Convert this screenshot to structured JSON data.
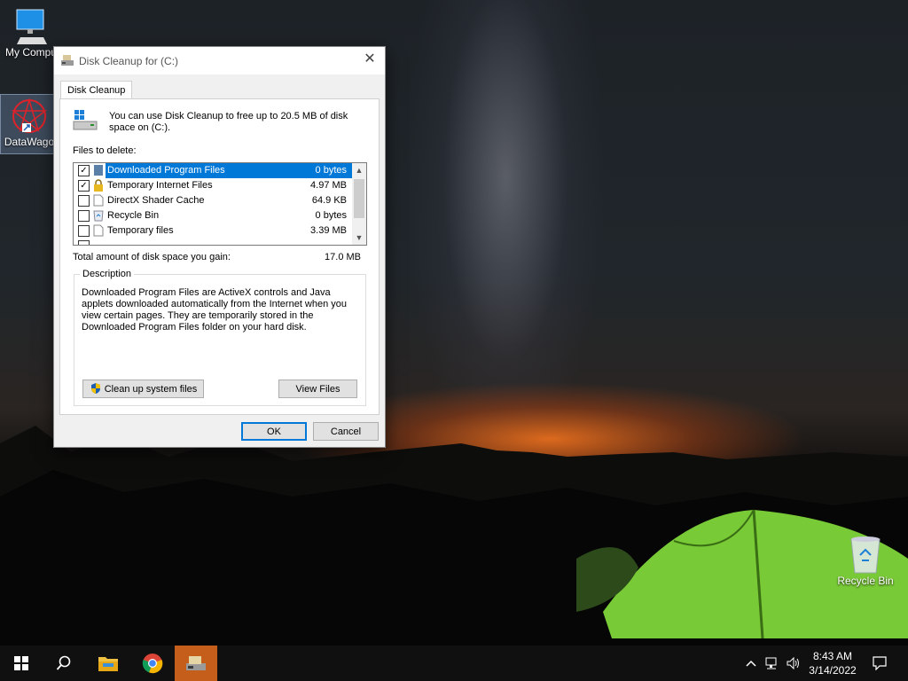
{
  "desktop": {
    "icons": [
      {
        "label": "My Compu"
      },
      {
        "label": "DataWago"
      },
      {
        "label": "Recycle Bin"
      }
    ]
  },
  "window": {
    "title": "Disk Cleanup for  (C:)",
    "tab": "Disk Cleanup",
    "intro": "You can use Disk Cleanup to free up to 20.5 MB of disk space on  (C:).",
    "files_label": "Files to delete:",
    "files": [
      {
        "name": "Downloaded Program Files",
        "size": "0 bytes",
        "checked": true,
        "selected": true,
        "icon": "folder-icon"
      },
      {
        "name": "Temporary Internet Files",
        "size": "4.97 MB",
        "checked": true,
        "selected": false,
        "icon": "lock-icon"
      },
      {
        "name": "DirectX Shader Cache",
        "size": "64.9 KB",
        "checked": false,
        "selected": false,
        "icon": "file-icon"
      },
      {
        "name": "Recycle Bin",
        "size": "0 bytes",
        "checked": false,
        "selected": false,
        "icon": "recycle-bin-icon"
      },
      {
        "name": "Temporary files",
        "size": "3.39 MB",
        "checked": false,
        "selected": false,
        "icon": "file-icon"
      }
    ],
    "total_label": "Total amount of disk space you gain:",
    "total_value": "17.0 MB",
    "description_title": "Description",
    "description": "Downloaded Program Files are ActiveX controls and Java applets downloaded automatically from the Internet when you view certain pages. They are temporarily stored in the Downloaded Program Files folder on your hard disk.",
    "cleanup_system_label": "Clean up system files",
    "view_files_label": "View Files",
    "ok_label": "OK",
    "cancel_label": "Cancel"
  },
  "taskbar": {
    "time": "8:43 AM",
    "date": "3/14/2022",
    "items": [
      "start-icon",
      "search-icon",
      "file-explorer-icon",
      "chrome-icon",
      "disk-cleanup-icon"
    ],
    "active_color": "#c55e1b"
  },
  "colors": {
    "selection": "#0078d7",
    "tent": "#7fdc3a"
  }
}
